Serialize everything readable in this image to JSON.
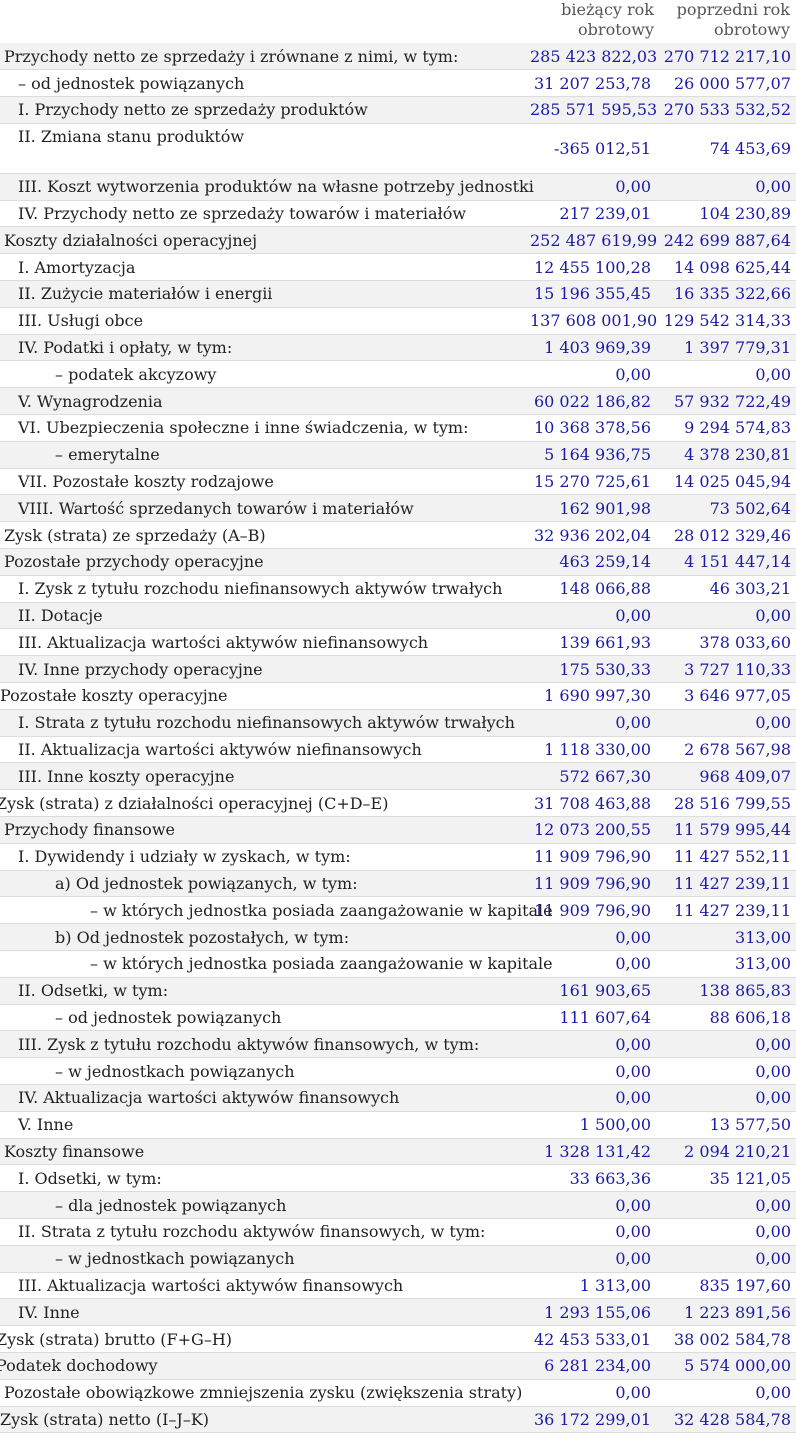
{
  "header": {
    "col_current": "bieżący rok obrotowy",
    "col_current_1": "bieżący rok",
    "col_current_2": "obrotowy",
    "col_prev_1": "poprzedni rok",
    "col_prev_2": "obrotowy"
  },
  "rows": [
    {
      "label": "Przychody netto ze sprzedaży i zrównane z nimi, w tym:",
      "v1": "285 423 822,03",
      "v2": "270 712 217,10",
      "lvl": "l0",
      "shade": true
    },
    {
      "label": "– od jednostek powiązanych",
      "v1": "31 207 253,78",
      "v2": "26 000 577,07",
      "lvl": "l1",
      "shade": false
    },
    {
      "label": "I. Przychody netto ze sprzedaży produktów",
      "v1": "285 571 595,53",
      "v2": "270 533 532,52",
      "lvl": "l2",
      "shade": true
    },
    {
      "label": "II. Zmiana stanu produktów",
      "v1": "-365 012,51",
      "v2": "74 453,69",
      "lvl": "l2",
      "shade": false,
      "tall": true
    },
    {
      "label": "III. Koszt wytworzenia produktów na własne potrzeby jednostki",
      "v1": "0,00",
      "v2": "0,00",
      "lvl": "l2",
      "shade": true
    },
    {
      "label": "IV. Przychody netto ze sprzedaży towarów i materiałów",
      "v1": "217 239,01",
      "v2": "104 230,89",
      "lvl": "l2",
      "shade": false
    },
    {
      "label": "Koszty działalności operacyjnej",
      "v1": "252 487 619,99",
      "v2": "242 699 887,64",
      "lvl": "l0",
      "shade": true
    },
    {
      "label": "I. Amortyzacja",
      "v1": "12 455 100,28",
      "v2": "14 098 625,44",
      "lvl": "l2",
      "shade": false
    },
    {
      "label": "II. Zużycie materiałów i energii",
      "v1": "15 196 355,45",
      "v2": "16 335 322,66",
      "lvl": "l2",
      "shade": true
    },
    {
      "label": "III. Usługi obce",
      "v1": "137 608 001,90",
      "v2": "129 542 314,33",
      "lvl": "l2",
      "shade": false
    },
    {
      "label": "IV. Podatki i opłaty, w tym:",
      "v1": "1 403 969,39",
      "v2": "1 397 779,31",
      "lvl": "l2",
      "shade": true
    },
    {
      "label": "– podatek akcyzowy",
      "v1": "0,00",
      "v2": "0,00",
      "lvl": "l3",
      "shade": false
    },
    {
      "label": "V. Wynagrodzenia",
      "v1": "60 022 186,82",
      "v2": "57 932 722,49",
      "lvl": "l2",
      "shade": true
    },
    {
      "label": "VI. Ubezpieczenia społeczne i inne świadczenia, w tym:",
      "v1": "10 368 378,56",
      "v2": "9 294 574,83",
      "lvl": "l2",
      "shade": false
    },
    {
      "label": "– emerytalne",
      "v1": "5 164 936,75",
      "v2": "4 378 230,81",
      "lvl": "l3",
      "shade": true
    },
    {
      "label": "VII. Pozostałe koszty rodzajowe",
      "v1": "15 270 725,61",
      "v2": "14 025 045,94",
      "lvl": "l2",
      "shade": false
    },
    {
      "label": "VIII. Wartość sprzedanych towarów i materiałów",
      "v1": "162 901,98",
      "v2": "73 502,64",
      "lvl": "l2",
      "shade": true
    },
    {
      "label": "Zysk (strata) ze sprzedaży (A–B)",
      "v1": "32 936 202,04",
      "v2": "28 012 329,46",
      "lvl": "l0",
      "shade": false
    },
    {
      "label": "Pozostałe przychody operacyjne",
      "v1": "463 259,14",
      "v2": "4 151 447,14",
      "lvl": "l0",
      "shade": true
    },
    {
      "label": "I. Zysk z tytułu rozchodu niefinansowych aktywów trwałych",
      "v1": "148 066,88",
      "v2": "46 303,21",
      "lvl": "l2",
      "shade": false
    },
    {
      "label": "II. Dotacje",
      "v1": "0,00",
      "v2": "0,00",
      "lvl": "l2",
      "shade": true
    },
    {
      "label": "III. Aktualizacja wartości aktywów niefinansowych",
      "v1": "139 661,93",
      "v2": "378 033,60",
      "lvl": "l2",
      "shade": false
    },
    {
      "label": "IV. Inne przychody operacyjne",
      "v1": "175 530,33",
      "v2": "3 727 110,33",
      "lvl": "l2",
      "shade": true
    },
    {
      "label": "Pozostałe koszty operacyjne",
      "v1": "1 690 997,30",
      "v2": "3 646 977,05",
      "lvl": "l0n",
      "shade": false
    },
    {
      "label": "I. Strata z tytułu rozchodu niefinansowych aktywów trwałych",
      "v1": "0,00",
      "v2": "0,00",
      "lvl": "l2",
      "shade": true
    },
    {
      "label": "II. Aktualizacja wartości aktywów niefinansowych",
      "v1": "1 118 330,00",
      "v2": "2 678 567,98",
      "lvl": "l2",
      "shade": false
    },
    {
      "label": "III. Inne koszty operacyjne",
      "v1": "572 667,30",
      "v2": "968 409,07",
      "lvl": "l2",
      "shade": true
    },
    {
      "label": "Zysk (strata) z działalności operacyjnej (C+D–E)",
      "v1": "31 708 463,88",
      "v2": "28 516 799,55",
      "lvl": "ln",
      "shade": false
    },
    {
      "label": "Przychody finansowe",
      "v1": "12 073 200,55",
      "v2": "11 579 995,44",
      "lvl": "l0",
      "shade": true
    },
    {
      "label": "I. Dywidendy i udziały w zyskach, w tym:",
      "v1": "11 909 796,90",
      "v2": "11 427 552,11",
      "lvl": "l2",
      "shade": false
    },
    {
      "label": "a) Od jednostek powiązanych, w tym:",
      "v1": "11 909 796,90",
      "v2": "11 427 239,11",
      "lvl": "l3",
      "shade": true
    },
    {
      "label": "– w których jednostka posiada zaangażowanie w kapitale",
      "v1": "11 909 796,90",
      "v2": "11 427 239,11",
      "lvl": "l4",
      "shade": false
    },
    {
      "label": "b) Od jednostek pozostałych, w tym:",
      "v1": "0,00",
      "v2": "313,00",
      "lvl": "l3",
      "shade": true
    },
    {
      "label": "– w których jednostka posiada zaangażowanie w kapitale",
      "v1": "0,00",
      "v2": "313,00",
      "lvl": "l4",
      "shade": false
    },
    {
      "label": "II. Odsetki, w tym:",
      "v1": "161 903,65",
      "v2": "138 865,83",
      "lvl": "l2",
      "shade": true
    },
    {
      "label": "– od jednostek powiązanych",
      "v1": "111 607,64",
      "v2": "88 606,18",
      "lvl": "l3",
      "shade": false
    },
    {
      "label": "III. Zysk z tytułu rozchodu aktywów finansowych, w tym:",
      "v1": "0,00",
      "v2": "0,00",
      "lvl": "l2",
      "shade": true
    },
    {
      "label": "– w jednostkach powiązanych",
      "v1": "0,00",
      "v2": "0,00",
      "lvl": "l3",
      "shade": false
    },
    {
      "label": "IV. Aktualizacja wartości aktywów finansowych",
      "v1": "0,00",
      "v2": "0,00",
      "lvl": "l2",
      "shade": true
    },
    {
      "label": "V. Inne",
      "v1": "1 500,00",
      "v2": "13 577,50",
      "lvl": "l2",
      "shade": false
    },
    {
      "label": "Koszty finansowe",
      "v1": "1 328 131,42",
      "v2": "2 094 210,21",
      "lvl": "l0",
      "shade": true
    },
    {
      "label": "I. Odsetki, w tym:",
      "v1": "33 663,36",
      "v2": "35 121,05",
      "lvl": "l2",
      "shade": false
    },
    {
      "label": "– dla jednostek powiązanych",
      "v1": "0,00",
      "v2": "0,00",
      "lvl": "l3",
      "shade": true
    },
    {
      "label": "II. Strata z tytułu rozchodu aktywów finansowych, w tym:",
      "v1": "0,00",
      "v2": "0,00",
      "lvl": "l2",
      "shade": false
    },
    {
      "label": "– w jednostkach powiązanych",
      "v1": "0,00",
      "v2": "0,00",
      "lvl": "l3",
      "shade": true
    },
    {
      "label": "III. Aktualizacja wartości aktywów finansowych",
      "v1": "1 313,00",
      "v2": "835 197,60",
      "lvl": "l2",
      "shade": false
    },
    {
      "label": "IV. Inne",
      "v1": "1 293 155,06",
      "v2": "1 223 891,56",
      "lvl": "l2",
      "shade": true
    },
    {
      "label": "Zysk (strata) brutto (F+G–H)",
      "v1": "42 453 533,01",
      "v2": "38 002 584,78",
      "lvl": "ln",
      "shade": false
    },
    {
      "label": "Podatek dochodowy",
      "v1": "6 281 234,00",
      "v2": "5 574 000,00",
      "lvl": "ln",
      "shade": true
    },
    {
      "label": "Pozostałe obowiązkowe zmniejszenia zysku (zwiększenia straty)",
      "v1": "0,00",
      "v2": "0,00",
      "lvl": "l0",
      "shade": false
    },
    {
      "label": "Zysk (strata) netto (I–J–K)",
      "v1": "36 172 299,01",
      "v2": "32 428 584,78",
      "lvl": "l0n",
      "shade": true
    }
  ]
}
